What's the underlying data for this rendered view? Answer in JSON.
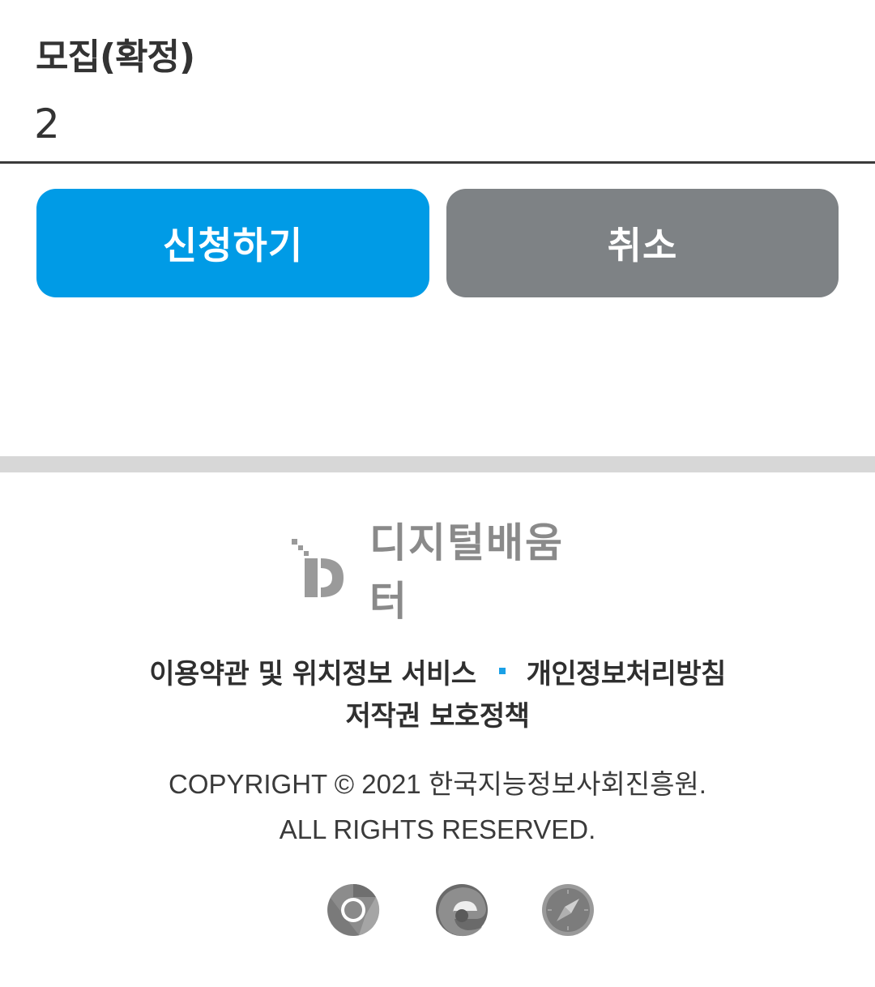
{
  "info": {
    "label": "모집(확정)",
    "value": "2"
  },
  "buttons": {
    "apply": "신청하기",
    "cancel": "취소"
  },
  "footer": {
    "logo_text": "디지털배움터",
    "links": {
      "terms": "이용약관 및 위치정보 서비스",
      "privacy": "개인정보처리방침",
      "copyright_policy": "저작권 보호정책"
    },
    "copyright_line1": "COPYRIGHT © 2021 한국지능정보사회진흥원.",
    "copyright_line2": "ALL RIGHTS RESERVED.",
    "browser_icons": [
      "chrome-icon",
      "edge-icon",
      "safari-icon"
    ]
  },
  "colors": {
    "primary": "#009be6",
    "secondary": "#7e8285",
    "separator": "#1aa0e6"
  }
}
